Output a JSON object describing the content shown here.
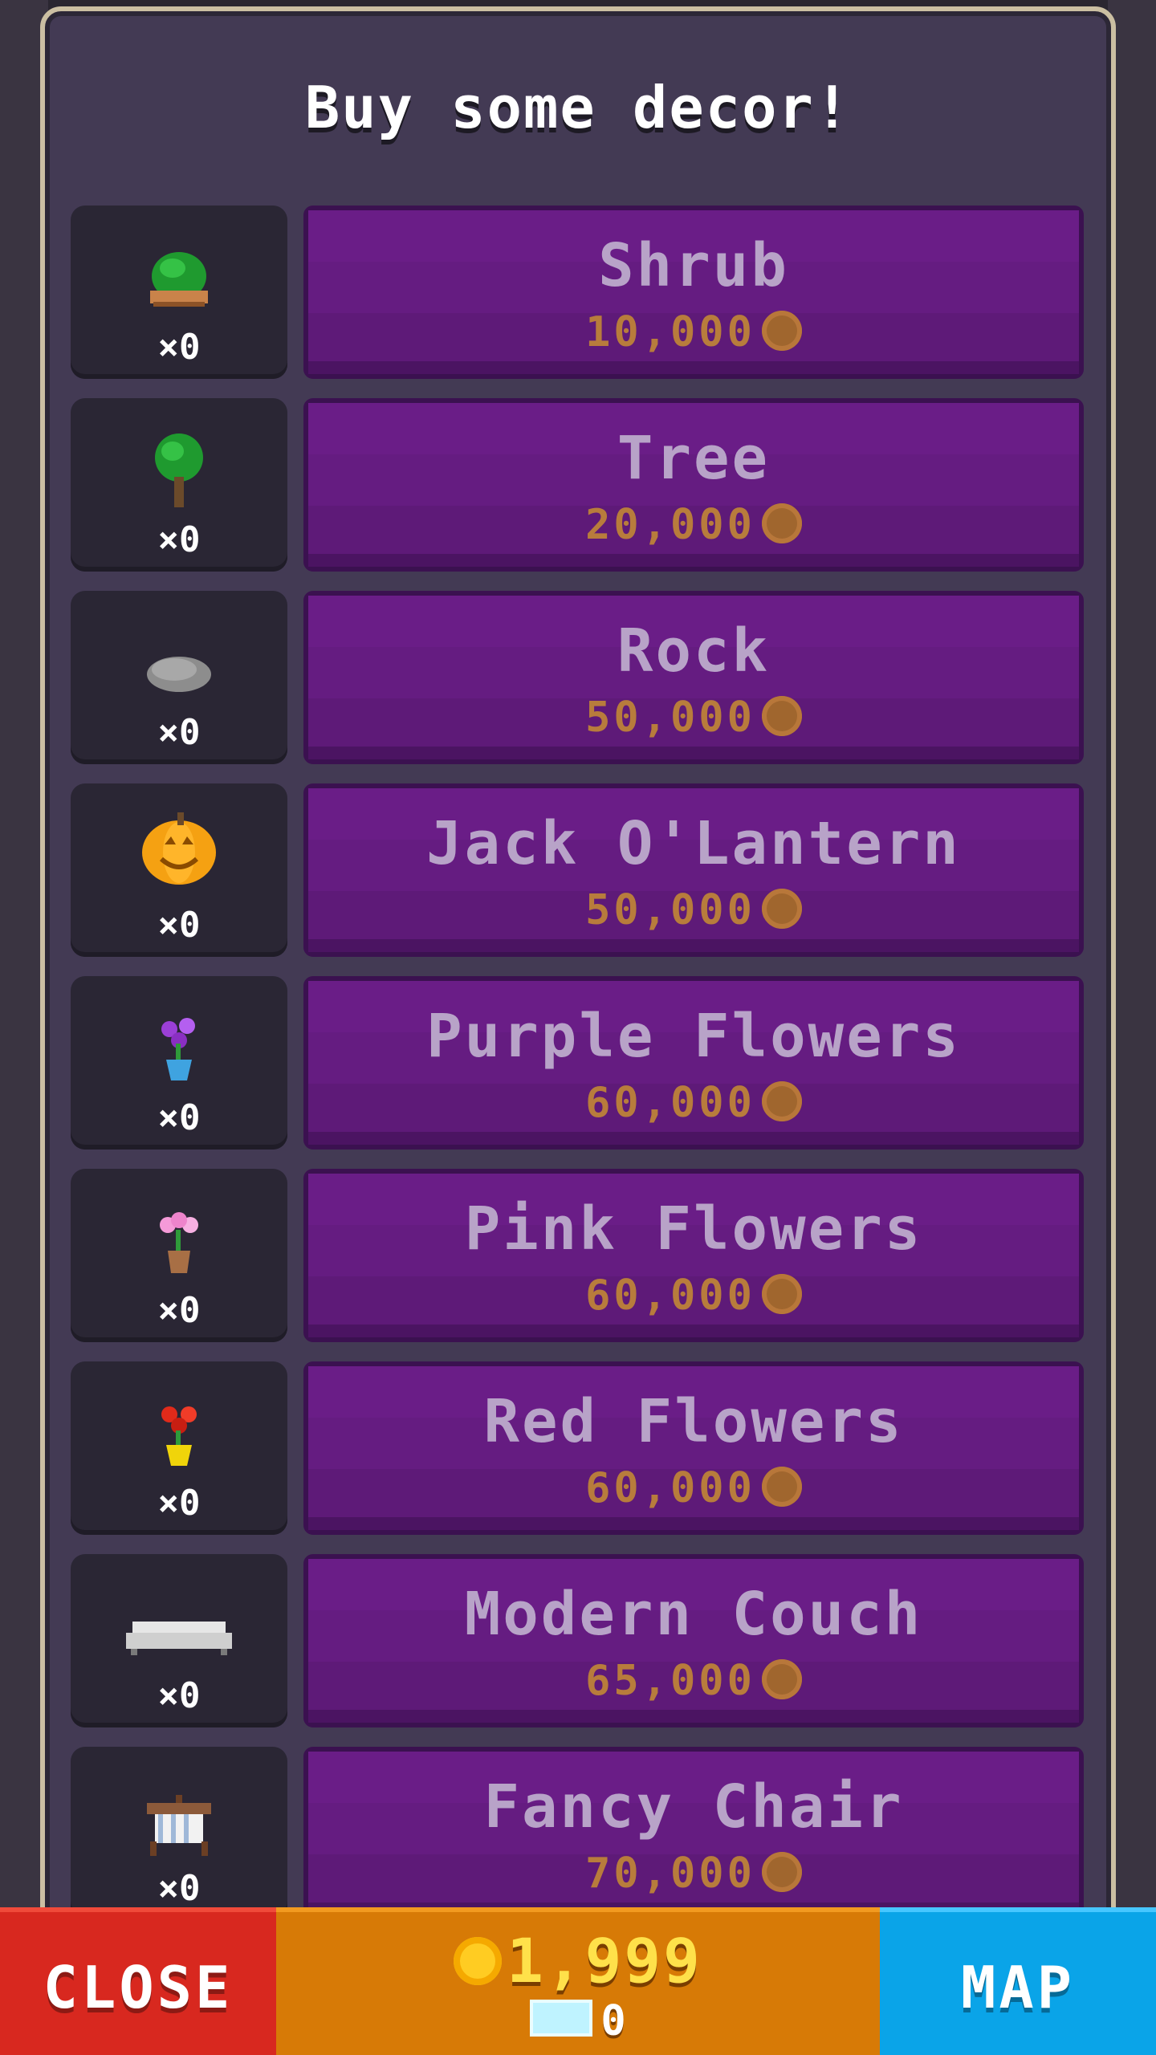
{
  "title": "Buy some decor!",
  "items": [
    {
      "name": "Shrub",
      "price": "10,000",
      "count": "×0",
      "icon": "shrub-icon"
    },
    {
      "name": "Tree",
      "price": "20,000",
      "count": "×0",
      "icon": "tree-icon"
    },
    {
      "name": "Rock",
      "price": "50,000",
      "count": "×0",
      "icon": "rock-icon"
    },
    {
      "name": "Jack O'Lantern",
      "price": "50,000",
      "count": "×0",
      "icon": "pumpkin-icon"
    },
    {
      "name": "Purple Flowers",
      "price": "60,000",
      "count": "×0",
      "icon": "purple-flowers-icon"
    },
    {
      "name": "Pink Flowers",
      "price": "60,000",
      "count": "×0",
      "icon": "pink-flowers-icon"
    },
    {
      "name": "Red Flowers",
      "price": "60,000",
      "count": "×0",
      "icon": "red-flowers-icon"
    },
    {
      "name": "Modern Couch",
      "price": "65,000",
      "count": "×0",
      "icon": "couch-icon"
    },
    {
      "name": "Fancy Chair",
      "price": "70,000",
      "count": "×0",
      "icon": "chair-icon"
    }
  ],
  "bottom_bar": {
    "close_label": "CLOSE",
    "map_label": "MAP",
    "coins": "1,999",
    "gems": "0"
  },
  "colors": {
    "panel": "#433a54",
    "buy_button": "#5e1a78",
    "close": "#d8281f",
    "wallet": "#d77a06",
    "map": "#0aa4e8"
  }
}
